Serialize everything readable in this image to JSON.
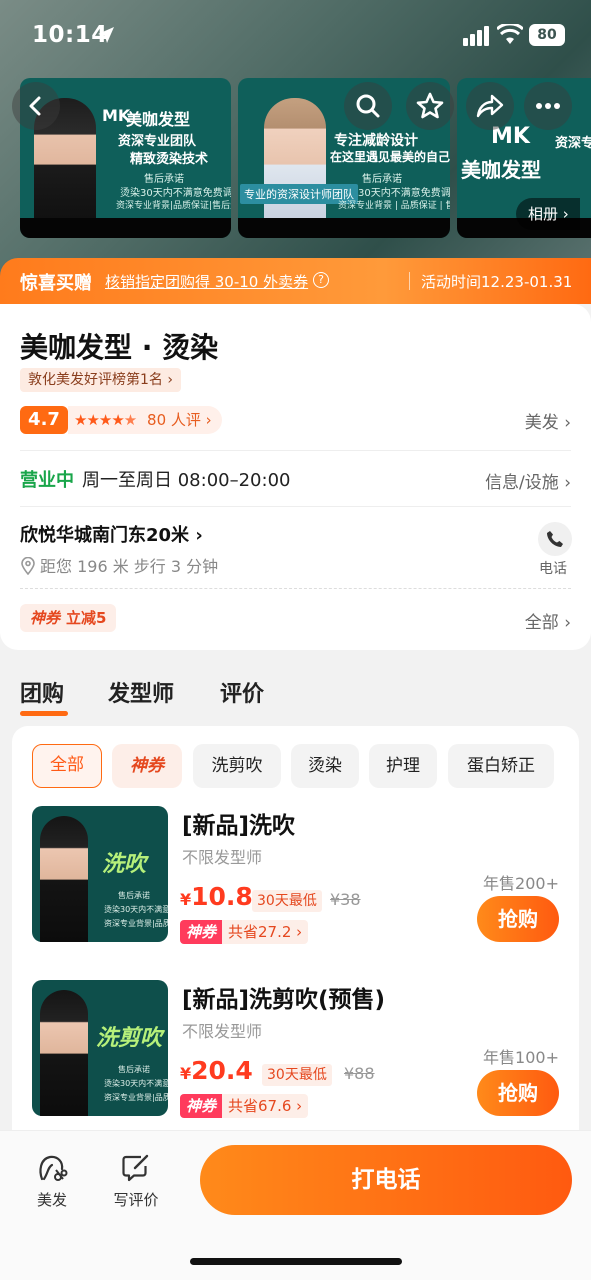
{
  "status_bar": {
    "time": "10:14",
    "battery": "80"
  },
  "gallery": {
    "album_label": "相册",
    "banners": [
      {
        "logo": "MK",
        "title": "美咖发型",
        "line1": "资深专业团队",
        "line2": "精致烫染技术",
        "promise": "售后承诺",
        "detail1": "烫染30天内不满意免费调整",
        "detail2": "资深专业背景|品质保证|售后无忧"
      },
      {
        "line1": "专注减龄设计",
        "line2": "在这里遇见最美的自己",
        "tag": "专业的资深设计师团队",
        "promise": "售后承诺",
        "detail1": "烫染30天内不满意免费调整",
        "detail2": "资深专业背景 | 品质保证 | 售后无忧"
      },
      {
        "logo": "MK",
        "title": "美咖发型",
        "line1": "资深专业"
      }
    ]
  },
  "promo": {
    "title": "惊喜买赠",
    "text": "核销指定团购得 30-10 外卖券",
    "date": "活动时间12.23-01.31"
  },
  "shop": {
    "name": "美咖发型 · 烫染",
    "rank": "敦化美发好评榜第1名",
    "score": "4.7",
    "reviews": "80 人评",
    "category": "美发",
    "status": "营业中",
    "hours": "周一至周日 08:00–20:00",
    "info_link": "信息/设施",
    "address": "欣悦华城南门东20米",
    "distance": "距您 196 米 步行 3 分钟",
    "phone_label": "电话",
    "coupon_tag": "神券",
    "coupon_text": "立减5",
    "coupon_all": "全部"
  },
  "tabs": [
    "团购",
    "发型师",
    "评价"
  ],
  "chips": [
    "全部",
    "神券",
    "洗剪吹",
    "烫染",
    "护理",
    "蛋白矫正"
  ],
  "deals": [
    {
      "name": "[新品]洗吹",
      "stylist": "不限发型师",
      "currency": "¥",
      "price": "10.8",
      "low_tag": "30天最低",
      "original": "¥38",
      "save_tag": "神券",
      "save_text": "共省27.2 ›",
      "sold": "年售200+",
      "buy_label": "抢购",
      "thumb_word": "洗吹",
      "thumb_promise": "售后承诺",
      "thumb_d1": "烫染30天内不满意",
      "thumb_d2": "资深专业背景|品质保"
    },
    {
      "name": "[新品]洗剪吹(预售)",
      "stylist": "不限发型师",
      "currency": "¥",
      "price": "20.4",
      "low_tag": "30天最低",
      "original": "¥88",
      "save_tag": "神券",
      "save_text": "共省67.6 ›",
      "sold": "年售100+",
      "buy_label": "抢购",
      "thumb_word": "洗剪吹",
      "thumb_promise": "售后承诺",
      "thumb_d1": "烫染30天内不满意",
      "thumb_d2": "资深专业背景|品质保"
    }
  ],
  "bottom": {
    "category_label": "美发",
    "review_label": "写评价",
    "call_label": "打电话"
  }
}
